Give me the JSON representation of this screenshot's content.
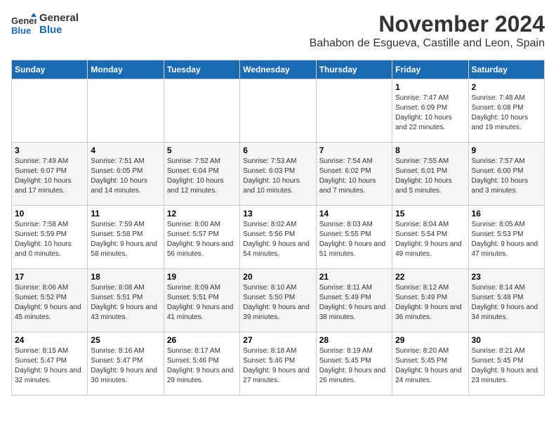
{
  "header": {
    "logo_line1": "General",
    "logo_line2": "Blue",
    "month_title": "November 2024",
    "location": "Bahabon de Esgueva, Castille and Leon, Spain"
  },
  "days_of_week": [
    "Sunday",
    "Monday",
    "Tuesday",
    "Wednesday",
    "Thursday",
    "Friday",
    "Saturday"
  ],
  "weeks": [
    [
      {
        "day": "",
        "info": ""
      },
      {
        "day": "",
        "info": ""
      },
      {
        "day": "",
        "info": ""
      },
      {
        "day": "",
        "info": ""
      },
      {
        "day": "",
        "info": ""
      },
      {
        "day": "1",
        "info": "Sunrise: 7:47 AM\nSunset: 6:09 PM\nDaylight: 10 hours and 22 minutes."
      },
      {
        "day": "2",
        "info": "Sunrise: 7:48 AM\nSunset: 6:08 PM\nDaylight: 10 hours and 19 minutes."
      }
    ],
    [
      {
        "day": "3",
        "info": "Sunrise: 7:49 AM\nSunset: 6:07 PM\nDaylight: 10 hours and 17 minutes."
      },
      {
        "day": "4",
        "info": "Sunrise: 7:51 AM\nSunset: 6:05 PM\nDaylight: 10 hours and 14 minutes."
      },
      {
        "day": "5",
        "info": "Sunrise: 7:52 AM\nSunset: 6:04 PM\nDaylight: 10 hours and 12 minutes."
      },
      {
        "day": "6",
        "info": "Sunrise: 7:53 AM\nSunset: 6:03 PM\nDaylight: 10 hours and 10 minutes."
      },
      {
        "day": "7",
        "info": "Sunrise: 7:54 AM\nSunset: 6:02 PM\nDaylight: 10 hours and 7 minutes."
      },
      {
        "day": "8",
        "info": "Sunrise: 7:55 AM\nSunset: 6:01 PM\nDaylight: 10 hours and 5 minutes."
      },
      {
        "day": "9",
        "info": "Sunrise: 7:57 AM\nSunset: 6:00 PM\nDaylight: 10 hours and 3 minutes."
      }
    ],
    [
      {
        "day": "10",
        "info": "Sunrise: 7:58 AM\nSunset: 5:59 PM\nDaylight: 10 hours and 0 minutes."
      },
      {
        "day": "11",
        "info": "Sunrise: 7:59 AM\nSunset: 5:58 PM\nDaylight: 9 hours and 58 minutes."
      },
      {
        "day": "12",
        "info": "Sunrise: 8:00 AM\nSunset: 5:57 PM\nDaylight: 9 hours and 56 minutes."
      },
      {
        "day": "13",
        "info": "Sunrise: 8:02 AM\nSunset: 5:56 PM\nDaylight: 9 hours and 54 minutes."
      },
      {
        "day": "14",
        "info": "Sunrise: 8:03 AM\nSunset: 5:55 PM\nDaylight: 9 hours and 51 minutes."
      },
      {
        "day": "15",
        "info": "Sunrise: 8:04 AM\nSunset: 5:54 PM\nDaylight: 9 hours and 49 minutes."
      },
      {
        "day": "16",
        "info": "Sunrise: 8:05 AM\nSunset: 5:53 PM\nDaylight: 9 hours and 47 minutes."
      }
    ],
    [
      {
        "day": "17",
        "info": "Sunrise: 8:06 AM\nSunset: 5:52 PM\nDaylight: 9 hours and 45 minutes."
      },
      {
        "day": "18",
        "info": "Sunrise: 8:08 AM\nSunset: 5:51 PM\nDaylight: 9 hours and 43 minutes."
      },
      {
        "day": "19",
        "info": "Sunrise: 8:09 AM\nSunset: 5:51 PM\nDaylight: 9 hours and 41 minutes."
      },
      {
        "day": "20",
        "info": "Sunrise: 8:10 AM\nSunset: 5:50 PM\nDaylight: 9 hours and 39 minutes."
      },
      {
        "day": "21",
        "info": "Sunrise: 8:11 AM\nSunset: 5:49 PM\nDaylight: 9 hours and 38 minutes."
      },
      {
        "day": "22",
        "info": "Sunrise: 8:12 AM\nSunset: 5:49 PM\nDaylight: 9 hours and 36 minutes."
      },
      {
        "day": "23",
        "info": "Sunrise: 8:14 AM\nSunset: 5:48 PM\nDaylight: 9 hours and 34 minutes."
      }
    ],
    [
      {
        "day": "24",
        "info": "Sunrise: 8:15 AM\nSunset: 5:47 PM\nDaylight: 9 hours and 32 minutes."
      },
      {
        "day": "25",
        "info": "Sunrise: 8:16 AM\nSunset: 5:47 PM\nDaylight: 9 hours and 30 minutes."
      },
      {
        "day": "26",
        "info": "Sunrise: 8:17 AM\nSunset: 5:46 PM\nDaylight: 9 hours and 29 minutes."
      },
      {
        "day": "27",
        "info": "Sunrise: 8:18 AM\nSunset: 5:46 PM\nDaylight: 9 hours and 27 minutes."
      },
      {
        "day": "28",
        "info": "Sunrise: 8:19 AM\nSunset: 5:45 PM\nDaylight: 9 hours and 26 minutes."
      },
      {
        "day": "29",
        "info": "Sunrise: 8:20 AM\nSunset: 5:45 PM\nDaylight: 9 hours and 24 minutes."
      },
      {
        "day": "30",
        "info": "Sunrise: 8:21 AM\nSunset: 5:45 PM\nDaylight: 9 hours and 23 minutes."
      }
    ]
  ]
}
